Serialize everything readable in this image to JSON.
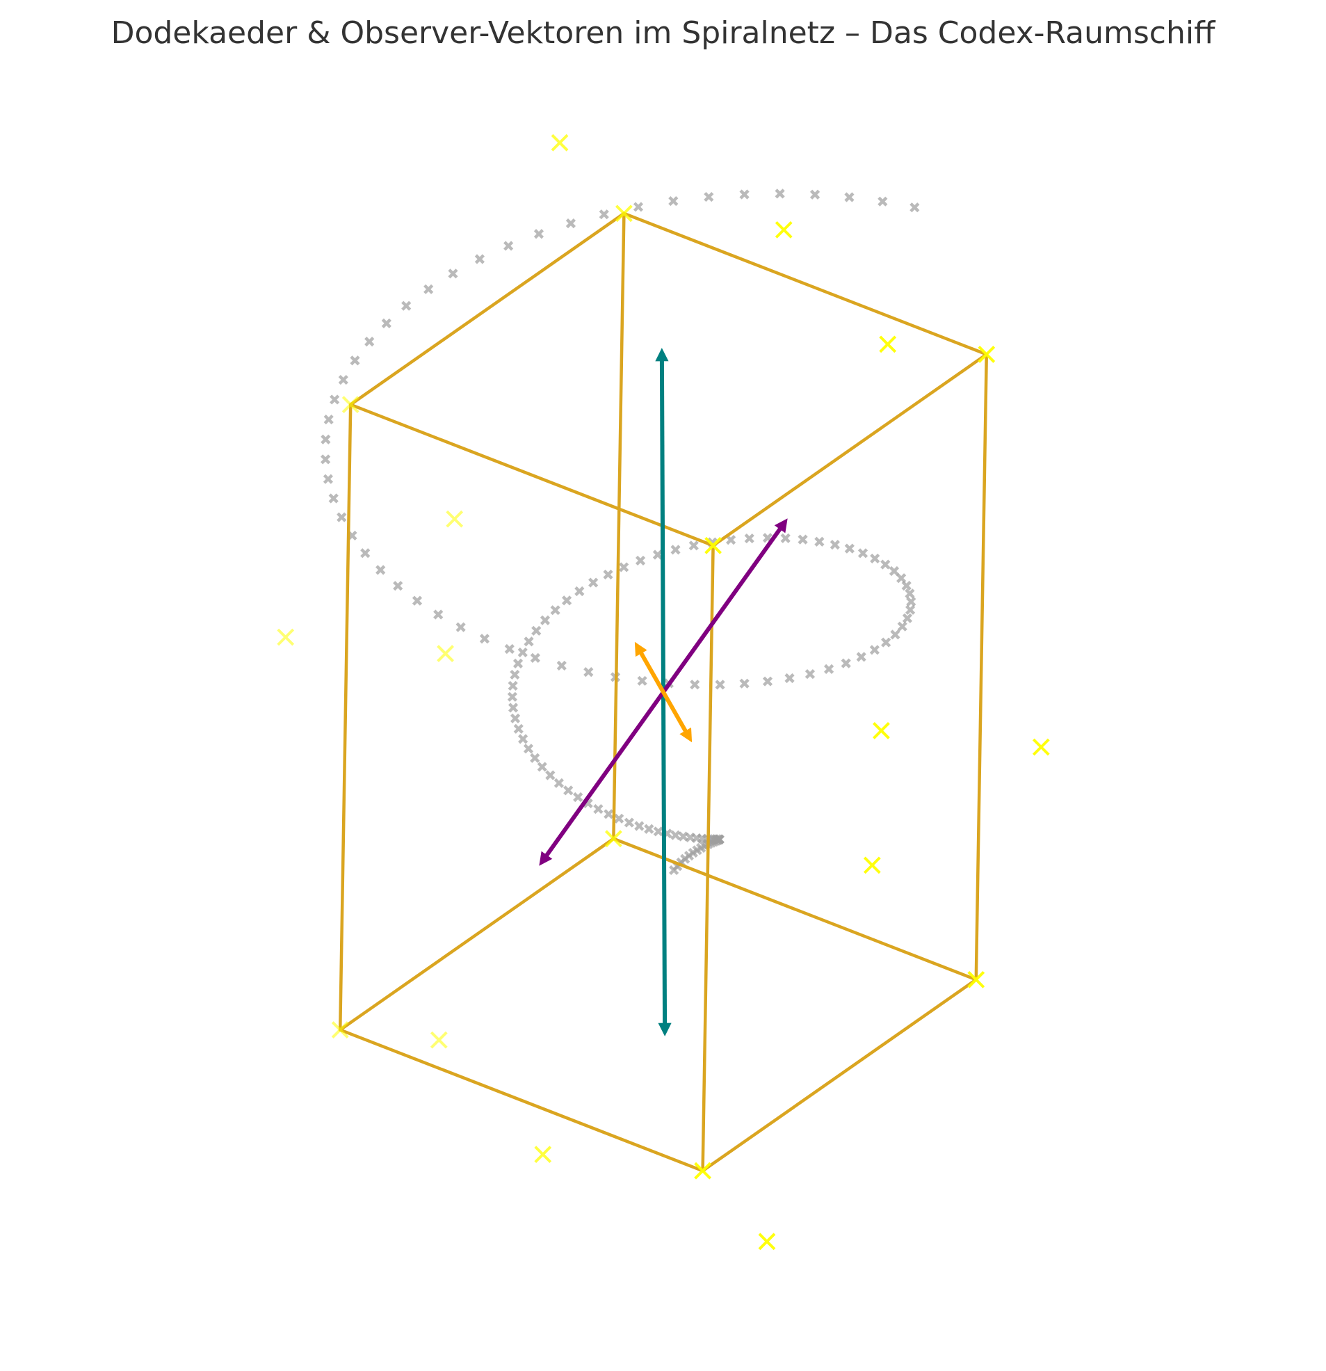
{
  "chart_data": {
    "type": "scatter",
    "projection": "3d",
    "axes_visible": false,
    "grid": false,
    "title": "Dodekaeder & Observer-Vektoren im Spiralnetz – Das Codex-Raumschiff",
    "colors": {
      "cube_edges": "#daa520",
      "dodecahedron_vertices": "#ffff00",
      "spiral_net": "#9e9e9e",
      "vector_teal": "#008080",
      "vector_purple": "#800080",
      "vector_orange": "#ffa500"
    },
    "cube": {
      "name": "Würfel",
      "vertices": [
        [
          -1,
          -1,
          -1
        ],
        [
          1,
          -1,
          -1
        ],
        [
          1,
          1,
          -1
        ],
        [
          -1,
          1,
          -1
        ],
        [
          -1,
          -1,
          1
        ],
        [
          1,
          -1,
          1
        ],
        [
          1,
          1,
          1
        ],
        [
          -1,
          1,
          1
        ]
      ],
      "edges": [
        [
          0,
          1
        ],
        [
          1,
          2
        ],
        [
          2,
          3
        ],
        [
          3,
          0
        ],
        [
          4,
          5
        ],
        [
          5,
          6
        ],
        [
          6,
          7
        ],
        [
          7,
          4
        ],
        [
          0,
          4
        ],
        [
          1,
          5
        ],
        [
          2,
          6
        ],
        [
          3,
          7
        ]
      ]
    },
    "dodecahedron": {
      "marker": "x",
      "vertices": [
        [
          1,
          1,
          1
        ],
        [
          1,
          1,
          -1
        ],
        [
          1,
          -1,
          1
        ],
        [
          1,
          -1,
          -1
        ],
        [
          -1,
          1,
          1
        ],
        [
          -1,
          1,
          -1
        ],
        [
          -1,
          -1,
          1
        ],
        [
          -1,
          -1,
          -1
        ],
        [
          0,
          0.618,
          1.618
        ],
        [
          0,
          0.618,
          -1.618
        ],
        [
          0,
          -0.618,
          1.618
        ],
        [
          0,
          -0.618,
          -1.618
        ],
        [
          0.618,
          1.618,
          0
        ],
        [
          0.618,
          -1.618,
          0
        ],
        [
          -0.618,
          1.618,
          0
        ],
        [
          -0.618,
          -1.618,
          0
        ],
        [
          1.618,
          0,
          0.618
        ],
        [
          1.618,
          0,
          -0.618
        ],
        [
          -1.618,
          0,
          0.618
        ],
        [
          -1.618,
          0,
          -0.618
        ]
      ]
    },
    "spiral": {
      "marker": "x",
      "points": 140,
      "radius_start": 0.1,
      "radius_end": 1.8,
      "turns": 2,
      "z_start": -0.6,
      "z_end": 1.0
    },
    "vectors": [
      {
        "color": "teal",
        "from": [
          -0.15,
          0.15,
          -1.0
        ],
        "to": [
          0.15,
          -0.15,
          1.0
        ]
      },
      {
        "color": "purple",
        "from": [
          -0.6,
          -0.2,
          -0.4
        ],
        "to": [
          0.6,
          0.2,
          0.4
        ]
      },
      {
        "color": "orange",
        "from": [
          -0.55,
          0.55,
          0.15
        ],
        "to": [
          0.55,
          -0.55,
          -0.15
        ]
      }
    ]
  }
}
